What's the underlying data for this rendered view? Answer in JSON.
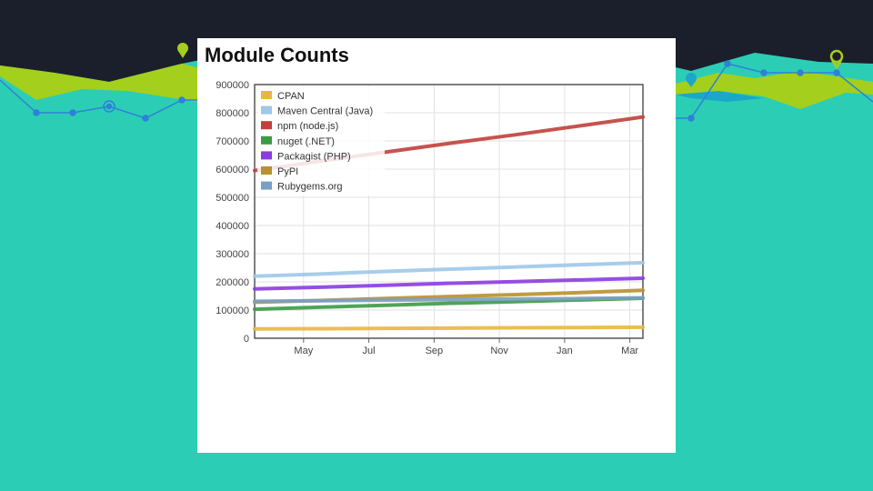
{
  "colors": {
    "top_band": "#1b1f2b",
    "background": "#2ccdb5",
    "lime": "#a4cf1c",
    "network_blue": "#2f80d8",
    "card": "#ffffff"
  },
  "decor": {
    "pin_icon_left": "location-pin-icon",
    "pin_icon_right": "location-pin-icon",
    "pin_icon_blue": "location-pin-icon"
  },
  "chart_data": {
    "type": "line",
    "title": "Module Counts",
    "xlabel": "",
    "ylabel": "",
    "x_tick_labels": [
      "May",
      "Jul",
      "Sep",
      "Nov",
      "Jan",
      "Mar"
    ],
    "x_tick_positions": [
      1.5,
      3.5,
      5.5,
      7.5,
      9.5,
      11.5
    ],
    "xlim": [
      0,
      11.9
    ],
    "ylim": [
      0,
      900000
    ],
    "y_ticks": [
      "0",
      "100000",
      "200000",
      "300000",
      "400000",
      "500000",
      "600000",
      "700000",
      "800000",
      "900000"
    ],
    "grid": true,
    "legend_position": "top-left",
    "x": [
      0,
      2,
      4,
      6,
      8,
      10,
      11.9
    ],
    "series": [
      {
        "name": "CPAN",
        "color": "#e8b83c",
        "values": [
          33000,
          34000,
          35000,
          36000,
          37000,
          38000,
          39000
        ]
      },
      {
        "name": "Maven Central (Java)",
        "color": "#9fc8e8",
        "values": [
          220000,
          228000,
          237000,
          245000,
          253000,
          261000,
          268000
        ]
      },
      {
        "name": "npm (node.js)",
        "color": "#c0403c",
        "values": [
          595000,
          628000,
          660000,
          692000,
          722000,
          754000,
          785000
        ]
      },
      {
        "name": "nuget (.NET)",
        "color": "#3c9a44",
        "values": [
          103000,
          110000,
          117000,
          124000,
          130000,
          136000,
          142000
        ]
      },
      {
        "name": "Packagist (PHP)",
        "color": "#8a3ce0",
        "values": [
          175000,
          181000,
          188000,
          195000,
          201000,
          207000,
          213000
        ]
      },
      {
        "name": "PyPI",
        "color": "#b8902e",
        "values": [
          128000,
          134000,
          141000,
          148000,
          155000,
          162000,
          170000
        ]
      },
      {
        "name": "Rubygems.org",
        "color": "#7a9fc4",
        "values": [
          131000,
          133000,
          135000,
          137000,
          139000,
          141000,
          143000
        ]
      }
    ]
  }
}
